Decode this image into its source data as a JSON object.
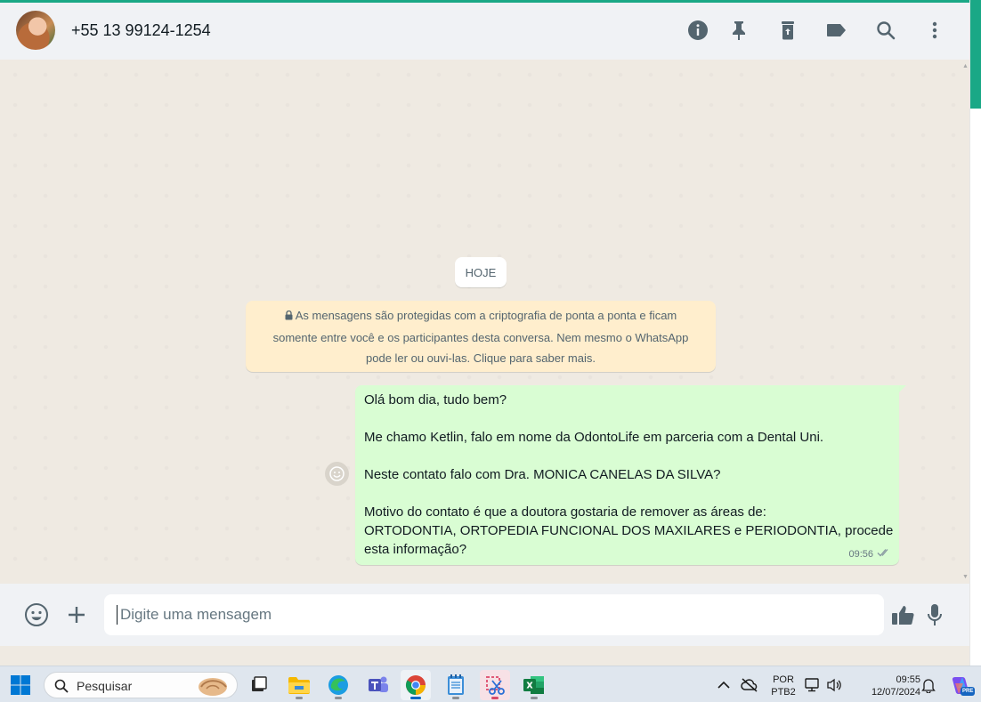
{
  "header": {
    "contact_name": "+55 13 99124-1254",
    "icons": [
      "info-icon",
      "pin-icon",
      "delete-icon",
      "label-icon",
      "search-icon",
      "menu-icon"
    ]
  },
  "chat": {
    "date_chip": "HOJE",
    "encryption_notice": {
      "line1": "As mensagens são protegidas com a criptografia de ponta a ponta e ficam",
      "line2": "somente entre você e os participantes desta conversa. Nem mesmo o WhatsApp",
      "line3": "pode ler ou ouvi-las. Clique para saber mais."
    },
    "message": {
      "lines": [
        "Olá bom dia, tudo bem?",
        "",
        "Me chamo Ketlin, falo em nome da OdontoLife em parceria com a Dental Uni.",
        "",
        "Neste contato falo com Dra. MONICA CANELAS DA SILVA?",
        "",
        "Motivo do contato é que a doutora gostaria de remover as áreas de:",
        "ORTODONTIA, ORTOPEDIA FUNCIONAL DOS MAXILARES e PERIODONTIA, procede",
        "esta informação?"
      ],
      "time": "09:56",
      "status": "delivered"
    }
  },
  "composer": {
    "placeholder": "Digite uma mensagem"
  },
  "taskbar": {
    "search_label": "Pesquisar",
    "language": "POR",
    "layout": "PTB2",
    "time": "09:55",
    "date": "12/07/2024",
    "copilot_badge": "PRE"
  },
  "colors": {
    "accent": "#1aa886",
    "outgoing_bubble": "#d9fdd3",
    "system_notice": "#ffeecd",
    "chat_bg": "#efeae2"
  }
}
